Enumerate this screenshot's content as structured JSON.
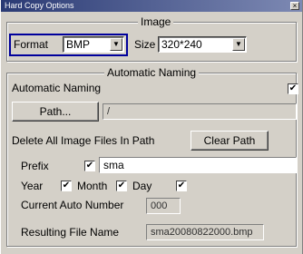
{
  "window": {
    "title": "Hard Copy Options",
    "close_glyph": "×"
  },
  "image_group": {
    "legend": "Image",
    "format_label": "Format",
    "format_value": "BMP",
    "size_label": "Size",
    "size_value": "320*240"
  },
  "naming_group": {
    "legend": "Automatic Naming",
    "auto_naming_label": "Automatic Naming",
    "auto_naming_checked": true,
    "path_button": "Path...",
    "path_value": "/",
    "delete_label": "Delete All Image Files In Path",
    "clear_path_button": "Clear Path",
    "prefix_label": "Prefix",
    "prefix_checked": true,
    "prefix_value": "sma",
    "year_label": "Year",
    "year_checked": true,
    "month_label": "Month",
    "month_checked": true,
    "day_label": "Day",
    "day_checked": true,
    "current_auto_number_label": "Current Auto Number",
    "current_auto_number_value": "000",
    "resulting_file_name_label": "Resulting File Name",
    "resulting_file_name_value": "sma20080822000.bmp"
  },
  "glyphs": {
    "checkmark": "✔",
    "dropdown_arrow": "▼"
  }
}
